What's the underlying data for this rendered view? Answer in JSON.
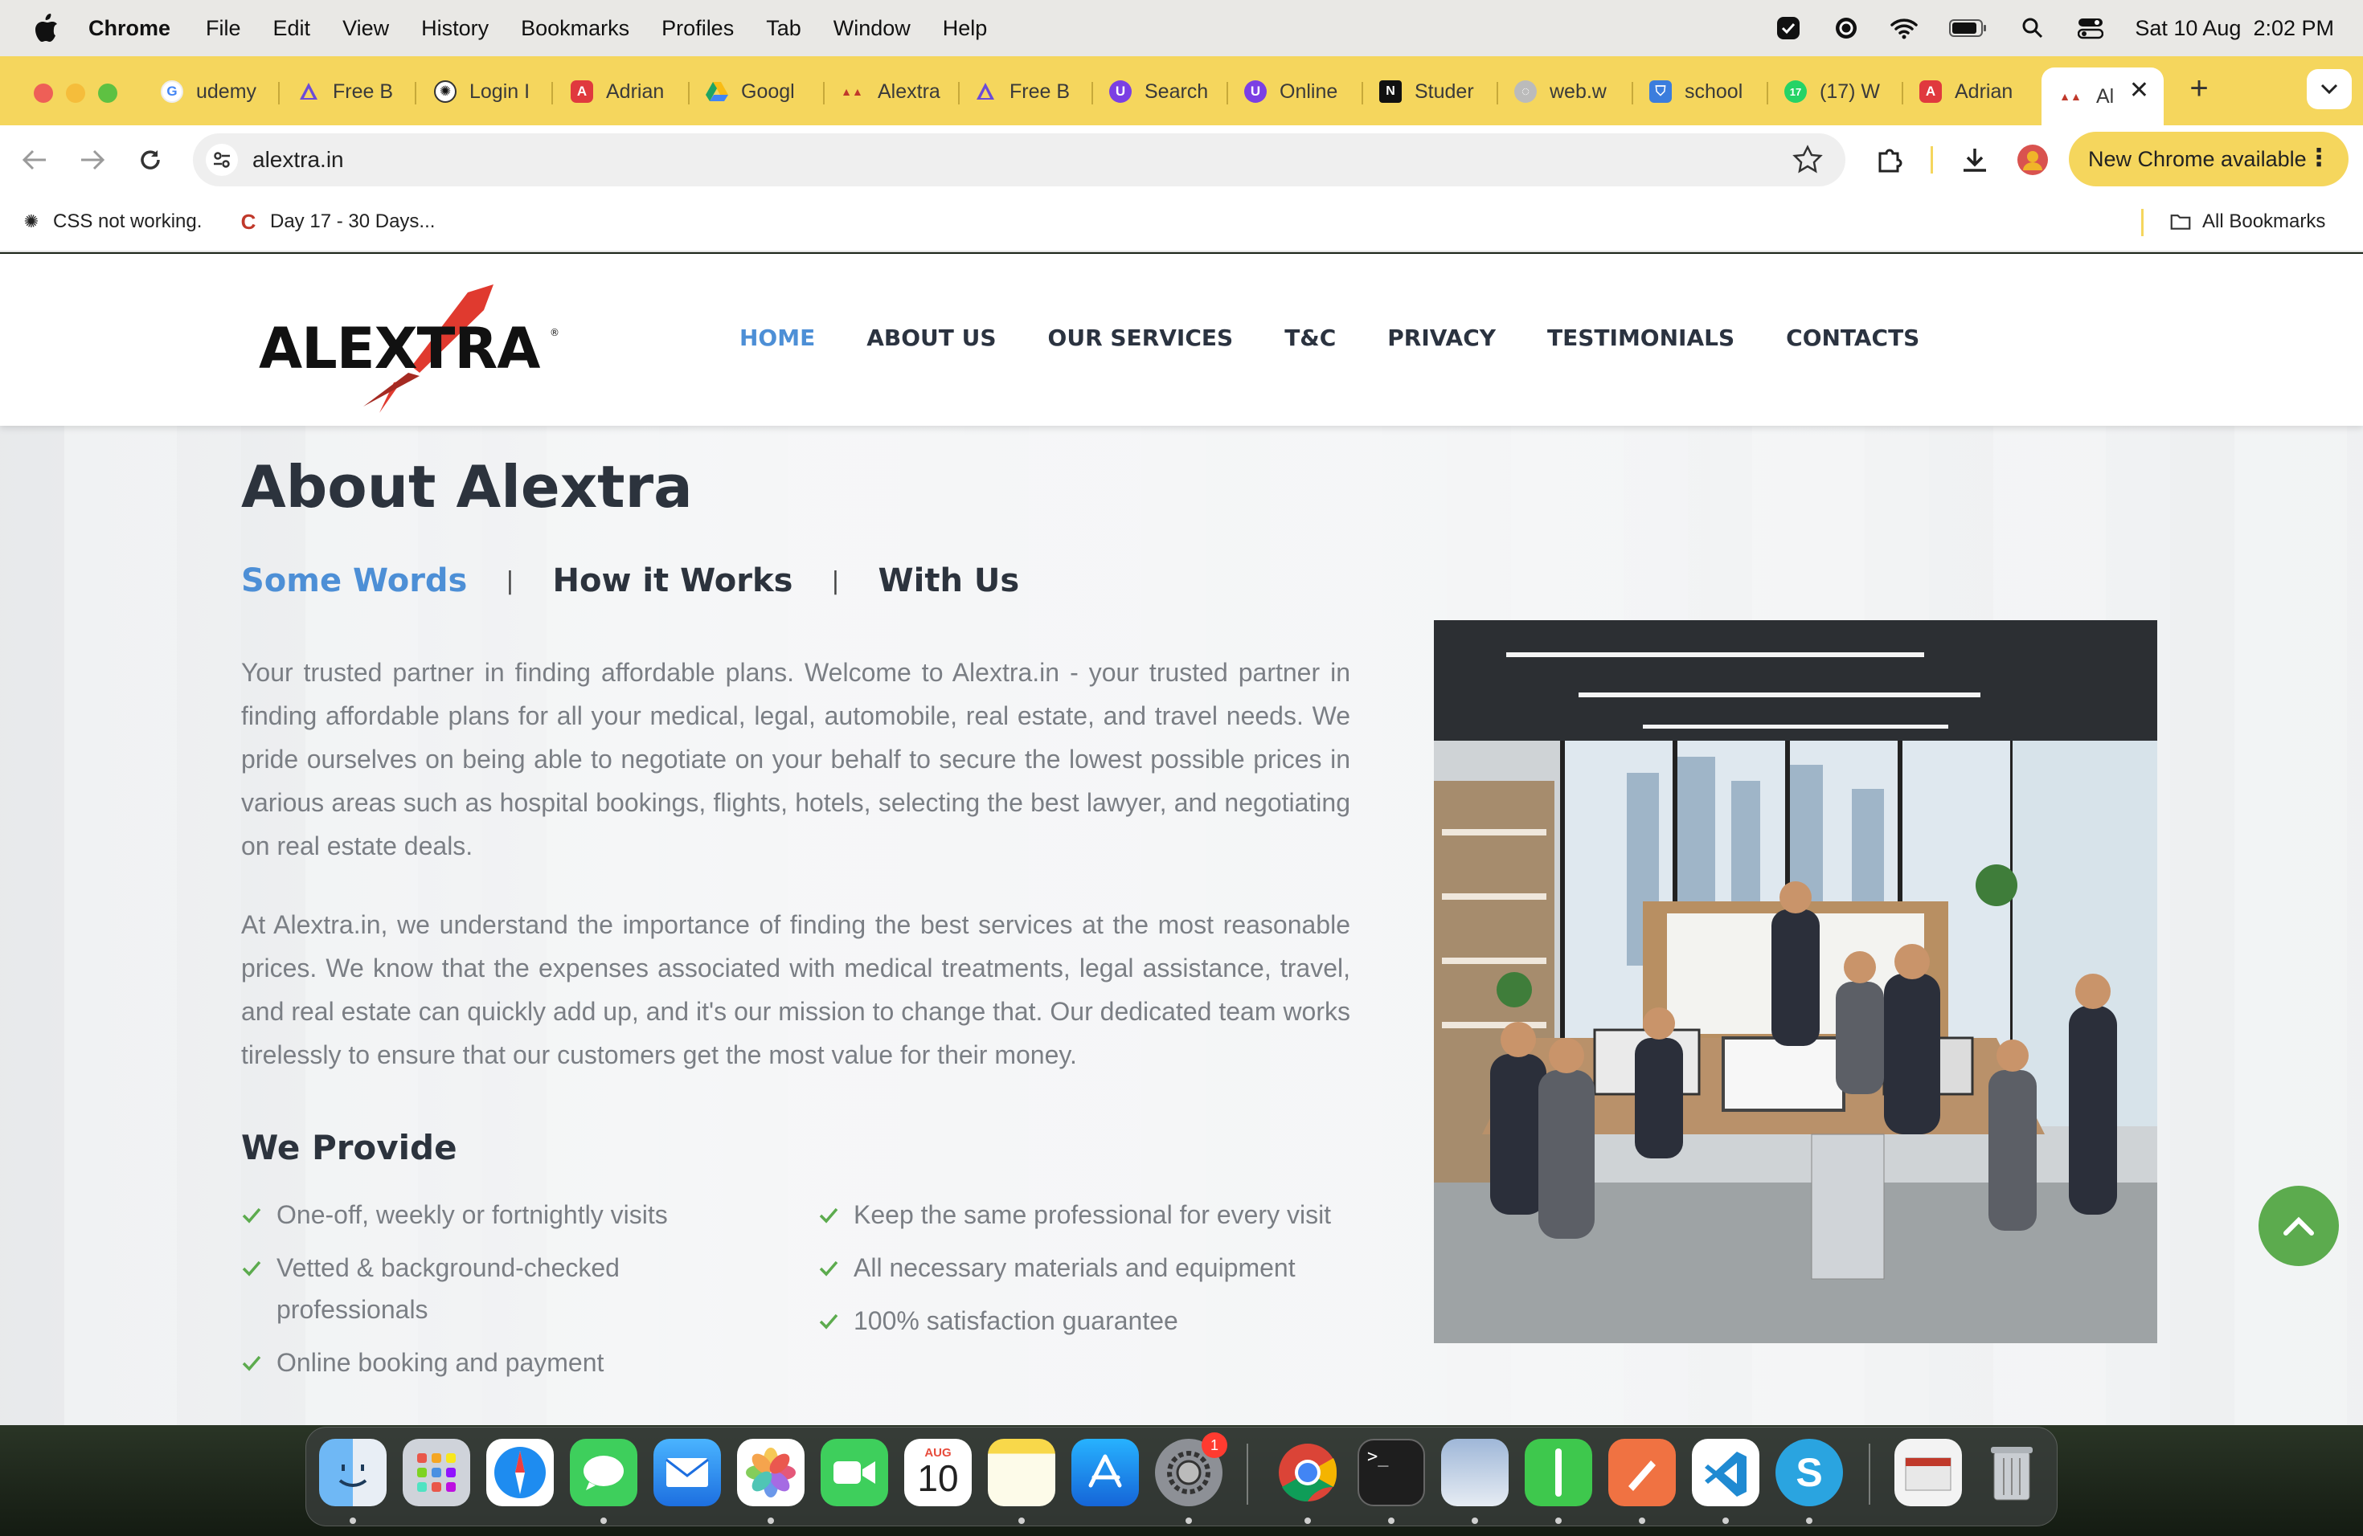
{
  "menubar": {
    "app": "Chrome",
    "items": [
      "File",
      "Edit",
      "View",
      "History",
      "Bookmarks",
      "Profiles",
      "Tab",
      "Window",
      "Help"
    ],
    "clock": "Sat 10 Aug  2:02 PM"
  },
  "tabs": [
    {
      "label": "udemy",
      "icon": "google-icon"
    },
    {
      "label": "Free B",
      "icon": "triangle-icon"
    },
    {
      "label": "Login I",
      "icon": "openai-icon"
    },
    {
      "label": "Adrian",
      "icon": "red-app-icon"
    },
    {
      "label": "Googl",
      "icon": "google-drive-icon"
    },
    {
      "label": "Alextra",
      "icon": "alextra-icon"
    },
    {
      "label": "Free B",
      "icon": "triangle-icon"
    },
    {
      "label": "Search",
      "icon": "purple-u-icon"
    },
    {
      "label": "Online",
      "icon": "purple-u-icon"
    },
    {
      "label": "Studer",
      "icon": "notion-icon"
    },
    {
      "label": "web.w",
      "icon": "globe-icon"
    },
    {
      "label": "school",
      "icon": "shield-icon"
    },
    {
      "label": "(17) W",
      "icon": "whatsapp-icon"
    },
    {
      "label": "Adrian",
      "icon": "red-app-icon"
    },
    {
      "label": "Al",
      "icon": "alextra-icon",
      "active": true
    }
  ],
  "toolbar": {
    "url": "alextra.in",
    "update_label": "New Chrome available"
  },
  "bookmarks": {
    "items": [
      {
        "label": "CSS not working.",
        "icon": "openai-icon"
      },
      {
        "label": "Day 17 - 30 Days...",
        "icon": "c-logo-icon"
      }
    ],
    "all_label": "All Bookmarks"
  },
  "site": {
    "nav": [
      "HOME",
      "ABOUT US",
      "OUR SERVICES",
      "T&C",
      "PRIVACY",
      "TESTIMONIALS",
      "CONTACTS"
    ],
    "active_nav": "HOME",
    "logo_text": "ALEXTRA",
    "about_title": "About Alextra",
    "about_tabs": [
      "Some Words",
      "How it Works",
      "With Us"
    ],
    "paragraph1": "Your trusted partner in finding affordable plans. Welcome to Alextra.in - your trusted partner in finding affordable plans for all your medical, legal, automobile, real estate, and travel needs. We pride ourselves on being able to negotiate on your behalf to secure the lowest possible prices in various areas such as hospital bookings, flights, hotels, selecting the best lawyer, and negotiating on real estate deals.",
    "paragraph2": "At Alextra.in, we understand the importance of finding the best services at the most reasonable prices. We know that the expenses associated with medical treatments, legal assistance, travel, and real estate can quickly add up, and it's our mission to change that. Our dedicated team works tirelessly to ensure that our customers get the most value for their money.",
    "provide_title": "We Provide",
    "provide_left": [
      "One-off, weekly or fortnightly visits",
      "Vetted & background-checked professionals",
      "Online booking and payment"
    ],
    "provide_right": [
      "Keep the same professional for every visit",
      "All necessary materials and equipment",
      "100% satisfaction guarantee"
    ]
  },
  "dock": {
    "calendar_month": "AUG",
    "calendar_day": "10",
    "settings_badge": "1"
  },
  "colors": {
    "tab_strip": "#f5d65d",
    "accent_blue": "#4d8fd6",
    "check_green": "#5cab4e",
    "heading": "#2c333d",
    "body_text": "#7a7e84"
  }
}
